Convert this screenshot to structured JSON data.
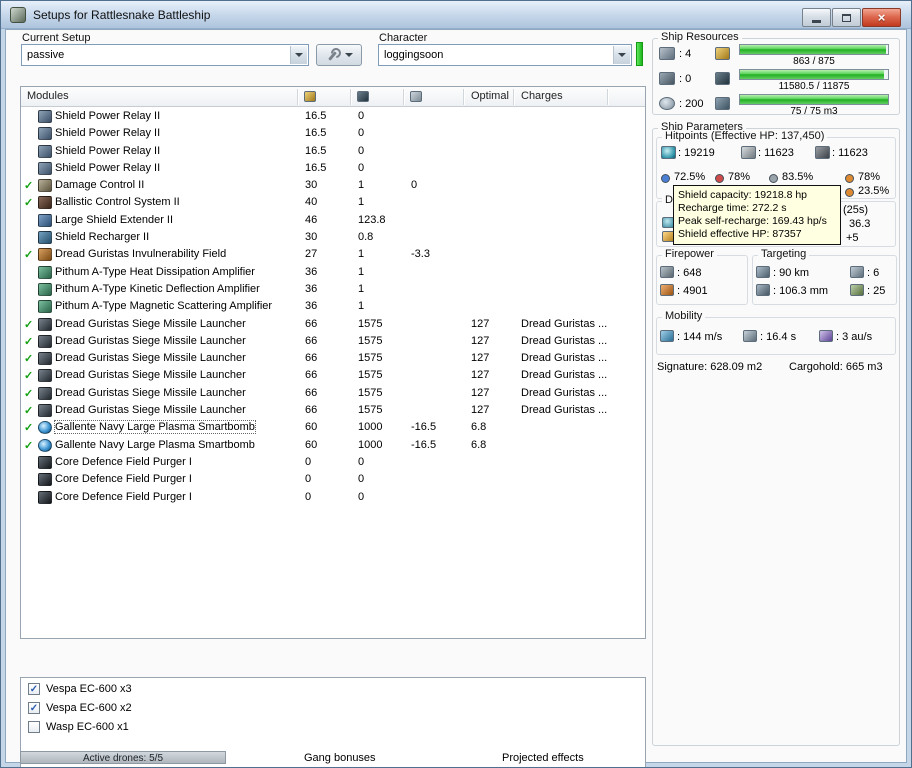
{
  "window": {
    "title": "Setups for Rattlesnake Battleship",
    "close_glyph": "×"
  },
  "toolbar": {
    "current_setup_label": "Current Setup",
    "current_setup_value": "passive",
    "character_label": "Character",
    "character_value": "loggingsoon"
  },
  "ship_resources": {
    "title": "Ship Resources",
    "rows": [
      {
        "slot_icon": "turret-hardpoints-icon",
        "slot_value": ": 4",
        "bar_icon": "cpu-icon",
        "bar_text": "863 / 875",
        "pct": 98.6
      },
      {
        "slot_icon": "launcher-hardpoints-icon",
        "slot_value": ": 0",
        "bar_icon": "powergrid-icon",
        "bar_text": "11580.5 / 11875",
        "pct": 97.5
      },
      {
        "slot_icon": "calibration-icon",
        "slot_value": ": 200",
        "bar_icon": "dronebay-icon",
        "bar_text": "75 / 75 m3",
        "pct": 100
      }
    ]
  },
  "modules_table": {
    "header": {
      "modules": "Modules",
      "optimal": "Optimal",
      "charges": "Charges"
    },
    "rows": [
      {
        "active": false,
        "selected": false,
        "icon": "spr",
        "name": "Shield Power Relay II",
        "cpu": "16.5",
        "pg": "0",
        "cap": "",
        "optimal": "",
        "charges": ""
      },
      {
        "active": false,
        "selected": false,
        "icon": "spr",
        "name": "Shield Power Relay II",
        "cpu": "16.5",
        "pg": "0",
        "cap": "",
        "optimal": "",
        "charges": ""
      },
      {
        "active": false,
        "selected": false,
        "icon": "spr",
        "name": "Shield Power Relay II",
        "cpu": "16.5",
        "pg": "0",
        "cap": "",
        "optimal": "",
        "charges": ""
      },
      {
        "active": false,
        "selected": false,
        "icon": "spr",
        "name": "Shield Power Relay II",
        "cpu": "16.5",
        "pg": "0",
        "cap": "",
        "optimal": "",
        "charges": ""
      },
      {
        "active": true,
        "selected": false,
        "icon": "dc",
        "name": "Damage Control II",
        "cpu": "30",
        "pg": "1",
        "cap": "0",
        "optimal": "",
        "charges": ""
      },
      {
        "active": true,
        "selected": false,
        "icon": "bcs",
        "name": "Ballistic Control System II",
        "cpu": "40",
        "pg": "1",
        "cap": "",
        "optimal": "",
        "charges": ""
      },
      {
        "active": false,
        "selected": false,
        "icon": "lse",
        "name": "Large Shield Extender II",
        "cpu": "46",
        "pg": "123.8",
        "cap": "",
        "optimal": "",
        "charges": ""
      },
      {
        "active": false,
        "selected": false,
        "icon": "srch",
        "name": "Shield Recharger II",
        "cpu": "30",
        "pg": "0.8",
        "cap": "",
        "optimal": "",
        "charges": ""
      },
      {
        "active": true,
        "selected": false,
        "icon": "invul",
        "name": "Dread Guristas Invulnerability Field",
        "cpu": "27",
        "pg": "1",
        "cap": "-3.3",
        "optimal": "",
        "charges": ""
      },
      {
        "active": false,
        "selected": false,
        "icon": "pithum",
        "name": "Pithum A-Type Heat Dissipation Amplifier",
        "cpu": "36",
        "pg": "1",
        "cap": "",
        "optimal": "",
        "charges": ""
      },
      {
        "active": false,
        "selected": false,
        "icon": "pithum",
        "name": "Pithum A-Type Kinetic Deflection Amplifier",
        "cpu": "36",
        "pg": "1",
        "cap": "",
        "optimal": "",
        "charges": ""
      },
      {
        "active": false,
        "selected": false,
        "icon": "pithum",
        "name": "Pithum A-Type Magnetic Scattering Amplifier",
        "cpu": "36",
        "pg": "1",
        "cap": "",
        "optimal": "",
        "charges": ""
      },
      {
        "active": true,
        "selected": false,
        "icon": "launcher",
        "name": "Dread Guristas Siege Missile Launcher",
        "cpu": "66",
        "pg": "1575",
        "cap": "",
        "optimal": "127",
        "charges": "Dread Guristas ..."
      },
      {
        "active": true,
        "selected": false,
        "icon": "launcher",
        "name": "Dread Guristas Siege Missile Launcher",
        "cpu": "66",
        "pg": "1575",
        "cap": "",
        "optimal": "127",
        "charges": "Dread Guristas ..."
      },
      {
        "active": true,
        "selected": false,
        "icon": "launcher",
        "name": "Dread Guristas Siege Missile Launcher",
        "cpu": "66",
        "pg": "1575",
        "cap": "",
        "optimal": "127",
        "charges": "Dread Guristas ..."
      },
      {
        "active": true,
        "selected": false,
        "icon": "launcher",
        "name": "Dread Guristas Siege Missile Launcher",
        "cpu": "66",
        "pg": "1575",
        "cap": "",
        "optimal": "127",
        "charges": "Dread Guristas ..."
      },
      {
        "active": true,
        "selected": false,
        "icon": "launcher",
        "name": "Dread Guristas Siege Missile Launcher",
        "cpu": "66",
        "pg": "1575",
        "cap": "",
        "optimal": "127",
        "charges": "Dread Guristas ..."
      },
      {
        "active": true,
        "selected": false,
        "icon": "launcher",
        "name": "Dread Guristas Siege Missile Launcher",
        "cpu": "66",
        "pg": "1575",
        "cap": "",
        "optimal": "127",
        "charges": "Dread Guristas ..."
      },
      {
        "active": true,
        "selected": true,
        "icon": "smartbomb",
        "name": "Gallente Navy Large Plasma Smartbomb",
        "cpu": "60",
        "pg": "1000",
        "cap": "-16.5",
        "optimal": "6.8",
        "charges": ""
      },
      {
        "active": true,
        "selected": false,
        "icon": "smartbomb",
        "name": "Gallente Navy Large Plasma Smartbomb",
        "cpu": "60",
        "pg": "1000",
        "cap": "-16.5",
        "optimal": "6.8",
        "charges": ""
      },
      {
        "active": false,
        "selected": false,
        "icon": "rig",
        "name": "Core Defence Field Purger I",
        "cpu": "0",
        "pg": "0",
        "cap": "",
        "optimal": "",
        "charges": ""
      },
      {
        "active": false,
        "selected": false,
        "icon": "rig",
        "name": "Core Defence Field Purger I",
        "cpu": "0",
        "pg": "0",
        "cap": "",
        "optimal": "",
        "charges": ""
      },
      {
        "active": false,
        "selected": false,
        "icon": "rig",
        "name": "Core Defence Field Purger I",
        "cpu": "0",
        "pg": "0",
        "cap": "",
        "optimal": "",
        "charges": ""
      }
    ]
  },
  "ship_parameters": {
    "title": "Ship Parameters",
    "hitpoints": {
      "label": "Hitpoints (Effective HP: 137,450)",
      "shield": ": 19219",
      "armor": ": 11623",
      "hull": ": 11623",
      "resists_row1": [
        "72.5%",
        "78%",
        "83.5%",
        "78%"
      ],
      "resists_row2_last": "23.5%"
    },
    "defense_fragments": {
      "label": "De",
      "top_right": "(25s)",
      "mid_right": "36.3",
      "bottom_right": "+5"
    },
    "firepower": {
      "label": "Firepower",
      "dps": ": 648",
      "volley": ": 4901"
    },
    "targeting": {
      "label": "Targeting",
      "range": ": 90 km",
      "max_targets": ": 6",
      "scan_resolution": ": 106.3 mm",
      "sensor_strength": ": 25"
    },
    "mobility": {
      "label": "Mobility",
      "max_velocity": ": 144 m/s",
      "align_time": ": 16.4 s",
      "warp_speed": ": 3 au/s"
    },
    "signature": "Signature: 628.09 m2",
    "cargohold": "Cargohold: 665 m3"
  },
  "tooltip": {
    "lines": [
      "Shield capacity: 19218.8 hp",
      "Recharge time: 272.2 s",
      "Peak self-recharge: 169.43 hp/s",
      "Shield effective HP: 87357"
    ]
  },
  "drones": {
    "items": [
      {
        "checked": true,
        "label": "Vespa EC-600 x3"
      },
      {
        "checked": true,
        "label": "Vespa EC-600 x2"
      },
      {
        "checked": false,
        "label": "Wasp EC-600 x1"
      }
    ]
  },
  "status_bar": {
    "active_drones": "Active drones: 5/5",
    "gang_bonuses": "Gang bonuses",
    "projected_effects": "Projected effects"
  },
  "colors": {
    "resists": [
      "#4a7fd4",
      "#cf4a4a",
      "#9aa2aa",
      "#de8a33"
    ],
    "bar_green": "#3cc13c",
    "tooltip_bg": "#ffffe1"
  }
}
